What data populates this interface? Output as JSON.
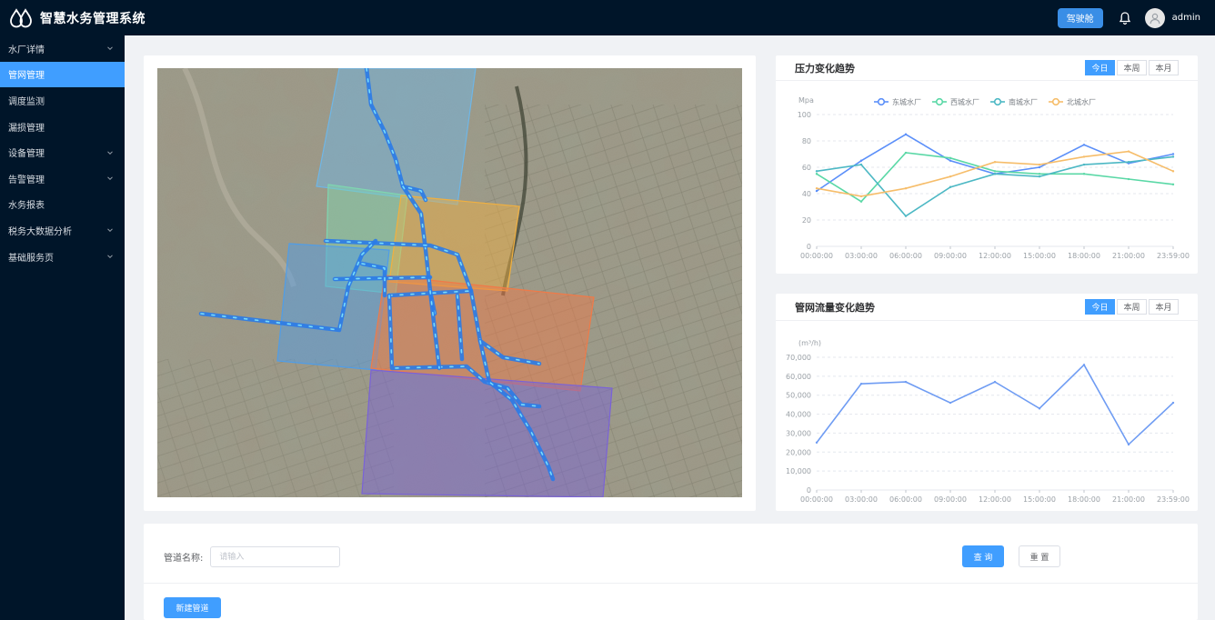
{
  "header": {
    "title": "智慧水务管理系统",
    "cockpit_label": "驾驶舱",
    "username": "admin"
  },
  "sidebar": {
    "items": [
      {
        "label": "水厂详情",
        "has_children": true
      },
      {
        "label": "管网管理",
        "has_children": false,
        "active": true
      },
      {
        "label": "调度监测",
        "has_children": false
      },
      {
        "label": "漏损管理",
        "has_children": false
      },
      {
        "label": "设备管理",
        "has_children": true
      },
      {
        "label": "告警管理",
        "has_children": true
      },
      {
        "label": "水务报表",
        "has_children": false
      },
      {
        "label": "税务大数据分析",
        "has_children": true
      },
      {
        "label": "基础服务页",
        "has_children": true
      }
    ]
  },
  "map": {
    "zones": [
      {
        "color": "#6fb6e6"
      },
      {
        "color": "#7fd6b0"
      },
      {
        "color": "#f0b040"
      },
      {
        "color": "#4f9de8"
      },
      {
        "color": "#f07a48"
      },
      {
        "color": "#7a62d8"
      }
    ]
  },
  "charts": {
    "periods": [
      "今日",
      "本周",
      "本月"
    ],
    "active_period": "今日"
  },
  "chart_data": [
    {
      "type": "line",
      "title": "压力变化趋势",
      "ylabel": "Mpa",
      "ylim": [
        0,
        100
      ],
      "yticks": [
        0,
        20,
        40,
        60,
        80,
        100
      ],
      "x": [
        "00:00:00",
        "03:00:00",
        "06:00:00",
        "09:00:00",
        "12:00:00",
        "15:00:00",
        "18:00:00",
        "21:00:00",
        "23:59:00"
      ],
      "legend_position": "top",
      "series": [
        {
          "name": "东城水厂",
          "color": "#5b8ff9",
          "values": [
            42,
            65,
            85,
            65,
            55,
            60,
            77,
            63,
            70
          ]
        },
        {
          "name": "西城水厂",
          "color": "#5ad8a6",
          "values": [
            55,
            34,
            71,
            67,
            57,
            55,
            55,
            51,
            47
          ]
        },
        {
          "name": "南城水厂",
          "color": "#4cb8c4",
          "values": [
            57,
            62,
            23,
            45,
            55,
            53,
            62,
            64,
            68
          ]
        },
        {
          "name": "北城水厂",
          "color": "#f6bd6a",
          "values": [
            44,
            38,
            44,
            53,
            64,
            62,
            68,
            72,
            57
          ]
        }
      ]
    },
    {
      "type": "line",
      "title": "管网流量变化趋势",
      "ylabel": "(m³/h)",
      "ylim": [
        0,
        70000
      ],
      "yticks": [
        0,
        10000,
        20000,
        30000,
        40000,
        50000,
        60000,
        70000
      ],
      "ytick_labels": [
        "0",
        "10,000",
        "20,000",
        "30,000",
        "40,000",
        "50,000",
        "60,000",
        "70,000"
      ],
      "x": [
        "00:00:00",
        "03:00:00",
        "06:00:00",
        "09:00:00",
        "12:00:00",
        "15:00:00",
        "18:00:00",
        "21:00:00",
        "23:59:00"
      ],
      "series": [
        {
          "color": "#6f9cf3",
          "values": [
            25000,
            56000,
            57000,
            46000,
            57000,
            43000,
            66000,
            24000,
            46000
          ]
        }
      ]
    }
  ],
  "search": {
    "name_label": "管道名称:",
    "name_placeholder": "请输入",
    "name_value": "",
    "query_label": "查 询",
    "reset_label": "重 置",
    "new_label": "新建管道"
  }
}
